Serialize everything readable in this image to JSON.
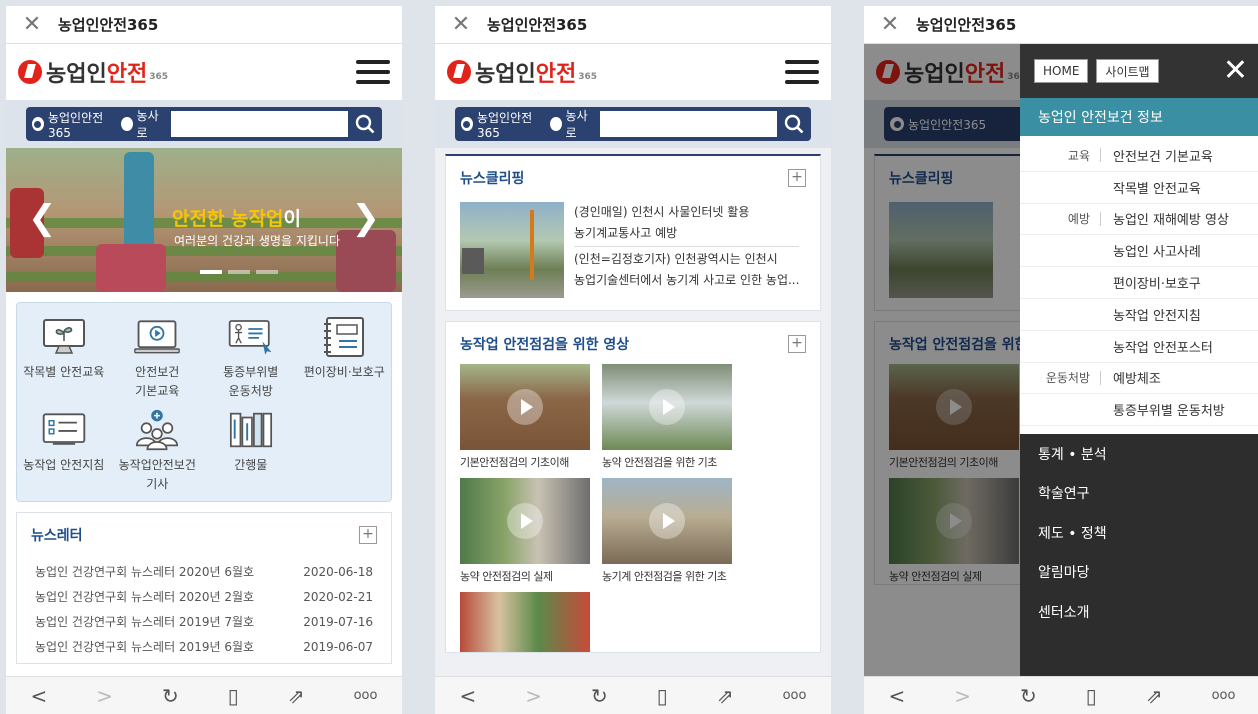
{
  "browser": {
    "title": "농업인안전365",
    "close_icon": "close-icon",
    "nav_icons": [
      "back-icon",
      "forward-icon",
      "refresh-icon",
      "bookmark-icon",
      "share-icon",
      "more-icon"
    ],
    "more_label": "ooo"
  },
  "brand": {
    "logo_prefix": "농업인",
    "logo_highlight": "안전",
    "logo_suffix": "365",
    "accent": "#e2231a"
  },
  "search": {
    "option1": "농업인안전365",
    "option2": "농사로",
    "selected": "농업인안전365",
    "placeholder": ""
  },
  "hero": {
    "headline_highlight": "안전한 농작업",
    "headline_suffix": "이",
    "subline": "여러분의 건강과 생명을 지킵니다"
  },
  "quick_menu": [
    {
      "label": "작목별 안전교육",
      "icon": "plant-monitor-icon"
    },
    {
      "label": "안전보건\n기본교육",
      "icon": "video-play-icon"
    },
    {
      "label": "통증부위별\n운동처방",
      "icon": "body-exercise-icon"
    },
    {
      "label": "편이장비·보호구",
      "icon": "notebook-icon"
    },
    {
      "label": "농작업 안전지침",
      "icon": "checklist-icon"
    },
    {
      "label": "농작업안전보건\n기사",
      "icon": "people-add-icon"
    },
    {
      "label": "간행물",
      "icon": "books-icon"
    }
  ],
  "newsletter": {
    "title": "뉴스레터",
    "plus": "+",
    "items": [
      {
        "title": "농업인 건강연구회 뉴스레터 2020년 6월호",
        "date": "2020-06-18"
      },
      {
        "title": "농업인 건강연구회 뉴스레터 2020년 2월호",
        "date": "2020-02-21"
      },
      {
        "title": "농업인 건강연구회 뉴스레터 2019년 7월호",
        "date": "2019-07-16"
      },
      {
        "title": "농업인 건강연구회 뉴스레터 2019년 6월호",
        "date": "2019-06-07"
      }
    ]
  },
  "news_clipping": {
    "title": "뉴스클리핑",
    "plus": "+",
    "headline_line1": "(경인매일) 인천시 사물인터넷 활용",
    "headline_line2": "농기계교통사고 예방",
    "desc_line1": "(인천=김정호기자) 인천광역시는 인천시",
    "desc_line2": "농업기술센터에서 농기계 사고로 인한 농업..."
  },
  "videos": {
    "title": "농작업 안전점검을 위한 영상",
    "plus": "+",
    "items": [
      {
        "caption": "기본안전점검의 기초이해"
      },
      {
        "caption": "농약 안전점검을 위한 기초"
      },
      {
        "caption": "농약 안전점검의 실제"
      },
      {
        "caption": "농기계 안전점검을 위한 기초"
      }
    ]
  },
  "drawer": {
    "home": "HOME",
    "sitemap": "사이트맵",
    "section": "농업인 안전보건 정보",
    "sub_items": [
      {
        "cat": "교육",
        "label": "안전보건 기본교육"
      },
      {
        "cat": "",
        "label": "작목별 안전교육"
      },
      {
        "cat": "예방",
        "label": "농업인 재해예방 영상"
      },
      {
        "cat": "",
        "label": "농업인 사고사례"
      },
      {
        "cat": "",
        "label": "편이장비·보호구"
      },
      {
        "cat": "",
        "label": "농작업 안전지침"
      },
      {
        "cat": "",
        "label": "농작업 안전포스터"
      },
      {
        "cat": "운동처방",
        "label": "예방체조"
      },
      {
        "cat": "",
        "label": "통증부위별 운동처방"
      }
    ],
    "main_items": [
      "통계 • 분석",
      "학술연구",
      "제도 • 정책",
      "알림마당",
      "센터소개"
    ],
    "section_color": "#3a8fa2"
  }
}
